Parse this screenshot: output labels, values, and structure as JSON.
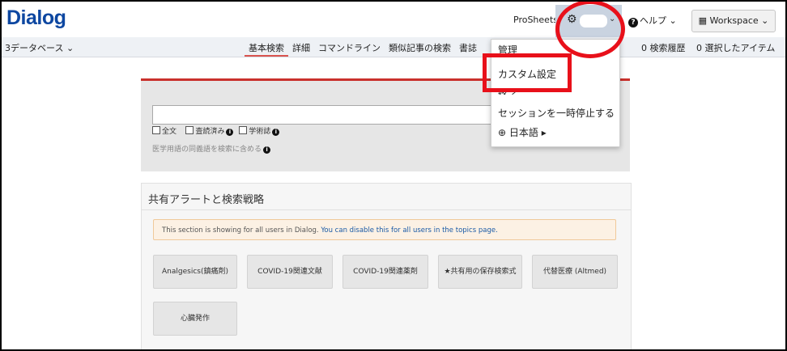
{
  "header": {
    "logo": "Dialog",
    "prosheets": "ProSheets",
    "account_caret": "⌄",
    "help_icon": "question-circle-icon",
    "help_label": "ヘルプ ⌄",
    "workspace_label": "Workspace ⌄"
  },
  "nav": {
    "databases_label": "3データベース ⌄",
    "tabs": [
      {
        "label": "基本検索",
        "active": true
      },
      {
        "label": "詳細"
      },
      {
        "label": "コマンドライン"
      },
      {
        "label": "類似記事の検索"
      },
      {
        "label": "書誌"
      }
    ],
    "search_history": "0 検索履歴",
    "selected_items": "0 選択したアイテム"
  },
  "search": {
    "input_value": "",
    "option_fulltext": "全文",
    "option_peer_reviewed": "査読済み",
    "option_scholarly": "学術誌",
    "synonym_label": "医学用語の同義語を検索に含める"
  },
  "shared": {
    "title": "共有アラートと検索戦略",
    "notice_text": "This section is showing for all users in Dialog.",
    "notice_link": "You can disable this for all users in the topics page.",
    "tiles": [
      "Analgesics(鎮痛剤)",
      "COVID-19関連文献",
      "COVID-19関連薬剤",
      "★共有用の保存検索式",
      "代替医療 (Altmed)",
      "心臓発作"
    ]
  },
  "menu": {
    "items": [
      "管理",
      "カスタム設定",
      "終了",
      "セッションを一時停止する",
      "日本語 ▸"
    ]
  },
  "colors": {
    "logo": "#0d47a1",
    "annotation": "#e8101a",
    "active_tab_underline": "#d9534f",
    "account_bg": "#c9d3e0"
  }
}
